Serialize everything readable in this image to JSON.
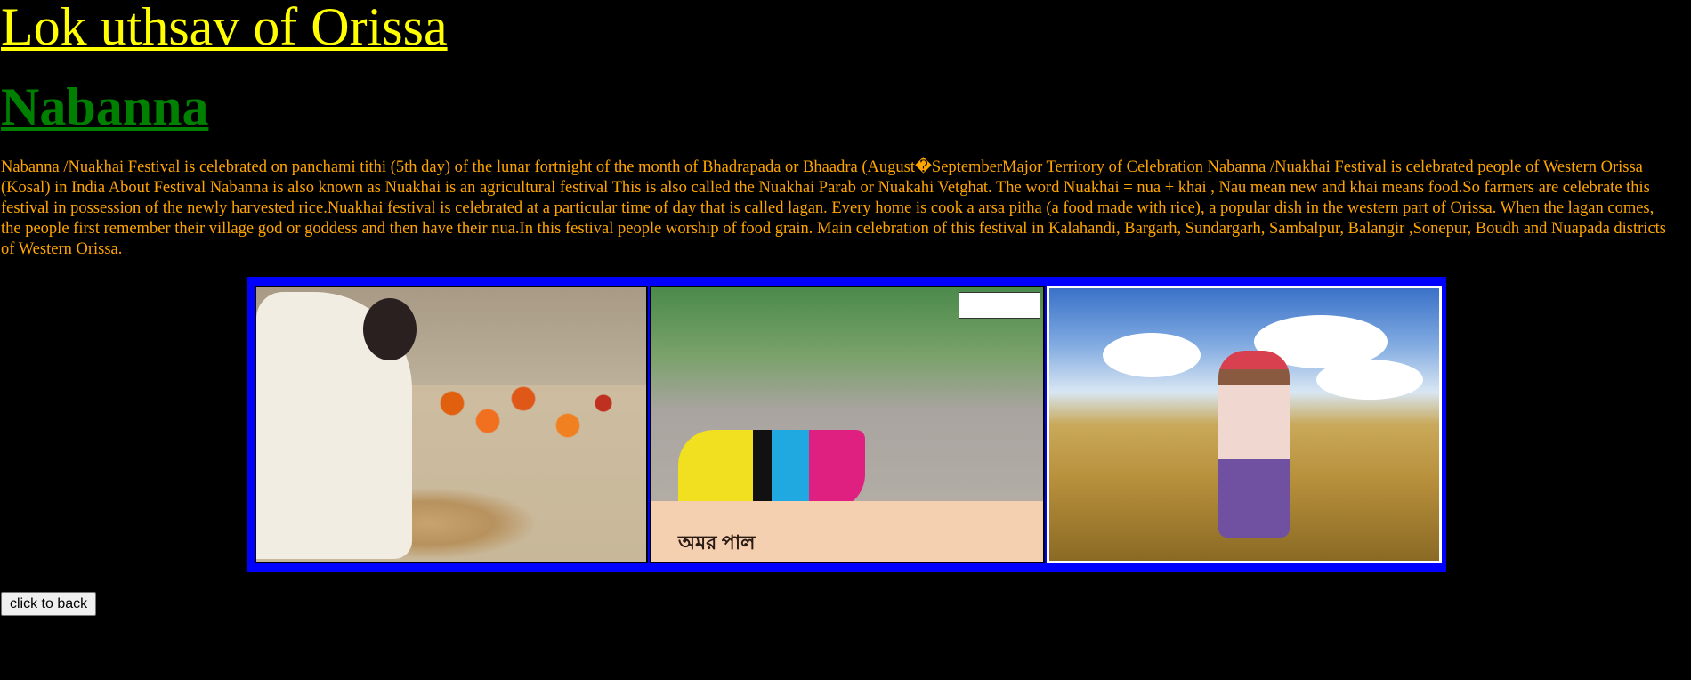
{
  "header": {
    "site_title": "Lok uthsav of Orissa",
    "page_heading": "Nabanna"
  },
  "article": {
    "body": "Nabanna /Nuakhai Festival is celebrated on panchami tithi (5th day) of the lunar fortnight of the month of Bhadrapada or Bhaadra (August�SeptemberMajor Territory of Celebration Nabanna /Nuakhai Festival is celebrated people of Western Orissa (Kosal) in India About Festival Nabanna is also known as Nuakhai is an agricultural festival This is also called the Nuakhai Parab or Nuakahi Vetghat. The word Nuakhai = nua + khai , Nau mean new and khai means food.So farmers are celebrate this festival in possession of the newly harvested rice.Nuakhai festival is celebrated at a particular time of day that is called lagan. Every home is cook a arsa pitha (a food made with rice), a popular dish in the western part of Orissa. When the lagan comes, the people first remember their village god or goddess and then have their nua.In this festival people worship of food grain. Main celebration of this festival in Kalahandi, Bargarh, Sundargarh, Sambalpur, Balangir ,Sonepur, Boudh and Nuapada districts of Western Orissa."
  },
  "gallery": {
    "border_color": "#0000ff",
    "images": [
      {
        "subject": "woman arranging rice grain offering with flowers"
      },
      {
        "subject": "Nabanna folk songs album cover",
        "cover_text": "অমর পাল"
      },
      {
        "subject": "farmers harvesting rice in a paddy field"
      }
    ]
  },
  "actions": {
    "back_label": "click to back"
  },
  "colors": {
    "background": "#000000",
    "site_title": "#ffff00",
    "page_heading": "#008000",
    "body_text": "#ffa500"
  }
}
